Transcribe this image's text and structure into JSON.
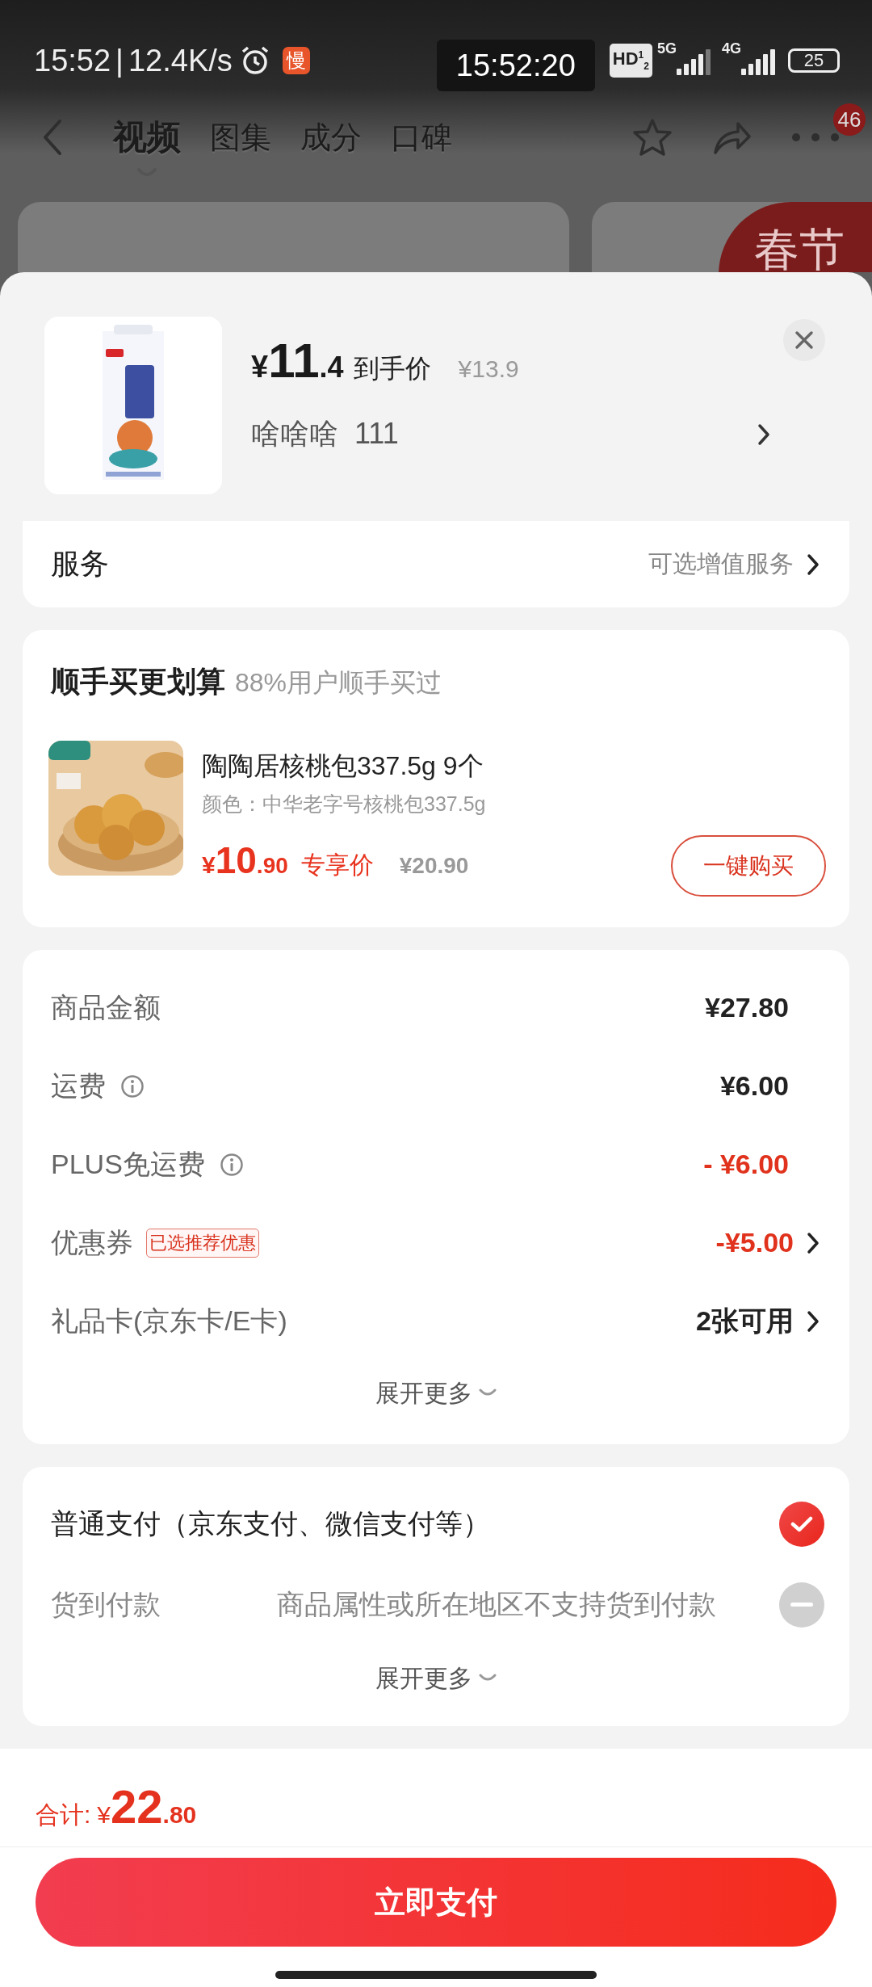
{
  "status_bar": {
    "time": "15:52",
    "separator": "|",
    "speed": "12.4K/s",
    "slow_badge": "慢",
    "clock_overlay": "15:52:20",
    "hd_badge": "HD$^{1}$$_{2}$",
    "network_5g": "5G",
    "network_4g": "4G",
    "battery": "25"
  },
  "nav": {
    "tabs": [
      {
        "label": "视频",
        "selected": true
      },
      {
        "label": "图集",
        "selected": false
      },
      {
        "label": "成分",
        "selected": false
      },
      {
        "label": "口碑",
        "selected": false
      }
    ],
    "message_badge": "46"
  },
  "promo_sticker": "春节",
  "product": {
    "kind": "picture",
    "price_symbol": "¥",
    "price_int": "11",
    "price_dec": ".4",
    "price_label": "到手价",
    "original_price": "¥13.9",
    "variant": "啥啥啥  111"
  },
  "service": {
    "label": "服务",
    "value": "可选增值服务"
  },
  "bundle": {
    "title": "顺手买更划算",
    "subtitle": "88%用户顺手买过",
    "item": {
      "kind": "picture",
      "name": "陶陶居核桃包337.5g 9个",
      "spec": "颜色：中华老字号核桃包337.5g",
      "price_symbol": "¥",
      "price_int": "10",
      "price_dec": ".90",
      "price_label": "专享价",
      "original_price": "¥20.90",
      "button": "一键购买"
    }
  },
  "fees": {
    "rows": [
      {
        "label": "商品金额",
        "info": false,
        "value": "¥27.80",
        "discount": false,
        "chevron": false
      },
      {
        "label": "运费",
        "info": true,
        "value": "¥6.00",
        "discount": false,
        "chevron": false
      },
      {
        "label": "PLUS免运费",
        "info": true,
        "value": "- ¥6.00",
        "discount": true,
        "chevron": false
      },
      {
        "label": "优惠券",
        "info": false,
        "tag": "已选推荐优惠",
        "value": "-¥5.00",
        "discount": true,
        "chevron": true
      },
      {
        "label": "礼品卡(京东卡/E卡)",
        "info": false,
        "value": "2张可用",
        "discount": false,
        "chevron": true
      }
    ],
    "expand": "展开更多"
  },
  "payment": {
    "methods": [
      {
        "label": "普通支付（京东支付、微信支付等）",
        "selected": true,
        "disabled": false
      },
      {
        "label": "货到付款",
        "note": "商品属性或所在地区不支持货到付款",
        "selected": false,
        "disabled": true
      }
    ],
    "expand": "展开更多"
  },
  "footer": {
    "total_label": "合计:",
    "price_symbol": "¥",
    "price_int": "22",
    "price_dec": ".80",
    "pay_button": "立即支付"
  }
}
